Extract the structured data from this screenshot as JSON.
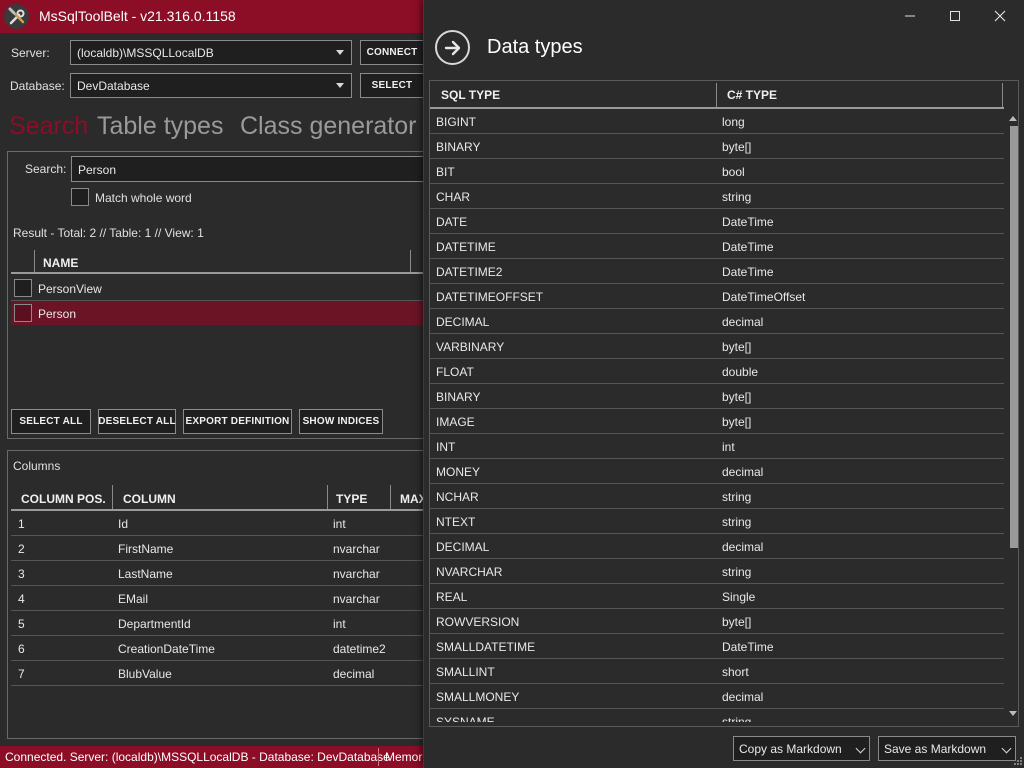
{
  "app": {
    "title": "MsSqlToolBelt - v21.316.0.1158",
    "accent_color": "#8b0d26"
  },
  "connection": {
    "server_label": "Server:",
    "server_value": "(localdb)\\MSSQLLocalDB",
    "connect_label": "CONNECT",
    "database_label": "Database:",
    "database_value": "DevDatabase",
    "select_label": "SELECT"
  },
  "tabs": [
    {
      "label": "Search",
      "active": true
    },
    {
      "label": "Table types",
      "active": false
    },
    {
      "label": "Class generator",
      "active": false
    }
  ],
  "search": {
    "label": "Search:",
    "value": "Person",
    "match_whole_word_label": "Match whole word",
    "match_whole_word_checked": false,
    "result_text": "Result - Total: 2 // Table: 1 // View: 1",
    "result_column_header": "NAME",
    "results": [
      {
        "name": "PersonView",
        "selected": false
      },
      {
        "name": "Person",
        "selected": true
      }
    ],
    "buttons": {
      "select_all": "SELECT ALL",
      "deselect_all": "DESELECT ALL",
      "export_definition": "EXPORT DEFINITION",
      "show_indices": "SHOW INDICES"
    }
  },
  "columns_panel": {
    "title": "Columns",
    "headers": [
      "COLUMN POS.",
      "COLUMN",
      "TYPE",
      "MAX"
    ],
    "rows": [
      {
        "pos": "1",
        "column": "Id",
        "type": "int"
      },
      {
        "pos": "2",
        "column": "FirstName",
        "type": "nvarchar"
      },
      {
        "pos": "3",
        "column": "LastName",
        "type": "nvarchar"
      },
      {
        "pos": "4",
        "column": "EMail",
        "type": "nvarchar"
      },
      {
        "pos": "5",
        "column": "DepartmentId",
        "type": "int"
      },
      {
        "pos": "6",
        "column": "CreationDateTime",
        "type": "datetime2"
      },
      {
        "pos": "7",
        "column": "BlubValue",
        "type": "decimal"
      }
    ]
  },
  "status": {
    "text": "Connected. Server: (localdb)\\MSSQLLocalDB - Database: DevDatabase",
    "memory_label": "Memor"
  },
  "data_types": {
    "title": "Data types",
    "headers": {
      "sql": "SQL TYPE",
      "cs": "C# TYPE"
    },
    "rows": [
      {
        "sql": "BIGINT",
        "cs": "long"
      },
      {
        "sql": "BINARY",
        "cs": "byte[]"
      },
      {
        "sql": "BIT",
        "cs": "bool"
      },
      {
        "sql": "CHAR",
        "cs": "string"
      },
      {
        "sql": "DATE",
        "cs": "DateTime"
      },
      {
        "sql": "DATETIME",
        "cs": "DateTime"
      },
      {
        "sql": "DATETIME2",
        "cs": "DateTime"
      },
      {
        "sql": "DATETIMEOFFSET",
        "cs": "DateTimeOffset"
      },
      {
        "sql": "DECIMAL",
        "cs": "decimal"
      },
      {
        "sql": "VARBINARY",
        "cs": "byte[]"
      },
      {
        "sql": "FLOAT",
        "cs": "double"
      },
      {
        "sql": "BINARY",
        "cs": "byte[]"
      },
      {
        "sql": "IMAGE",
        "cs": "byte[]"
      },
      {
        "sql": "INT",
        "cs": "int"
      },
      {
        "sql": "MONEY",
        "cs": "decimal"
      },
      {
        "sql": "NCHAR",
        "cs": "string"
      },
      {
        "sql": "NTEXT",
        "cs": "string"
      },
      {
        "sql": "DECIMAL",
        "cs": "decimal"
      },
      {
        "sql": "NVARCHAR",
        "cs": "string"
      },
      {
        "sql": "REAL",
        "cs": "Single"
      },
      {
        "sql": "ROWVERSION",
        "cs": "byte[]"
      },
      {
        "sql": "SMALLDATETIME",
        "cs": "DateTime"
      },
      {
        "sql": "SMALLINT",
        "cs": "short"
      },
      {
        "sql": "SMALLMONEY",
        "cs": "decimal"
      },
      {
        "sql": "SYSNAME",
        "cs": "string"
      }
    ],
    "copy_option": "Copy as Markdown",
    "save_option": "Save as Markdown"
  }
}
